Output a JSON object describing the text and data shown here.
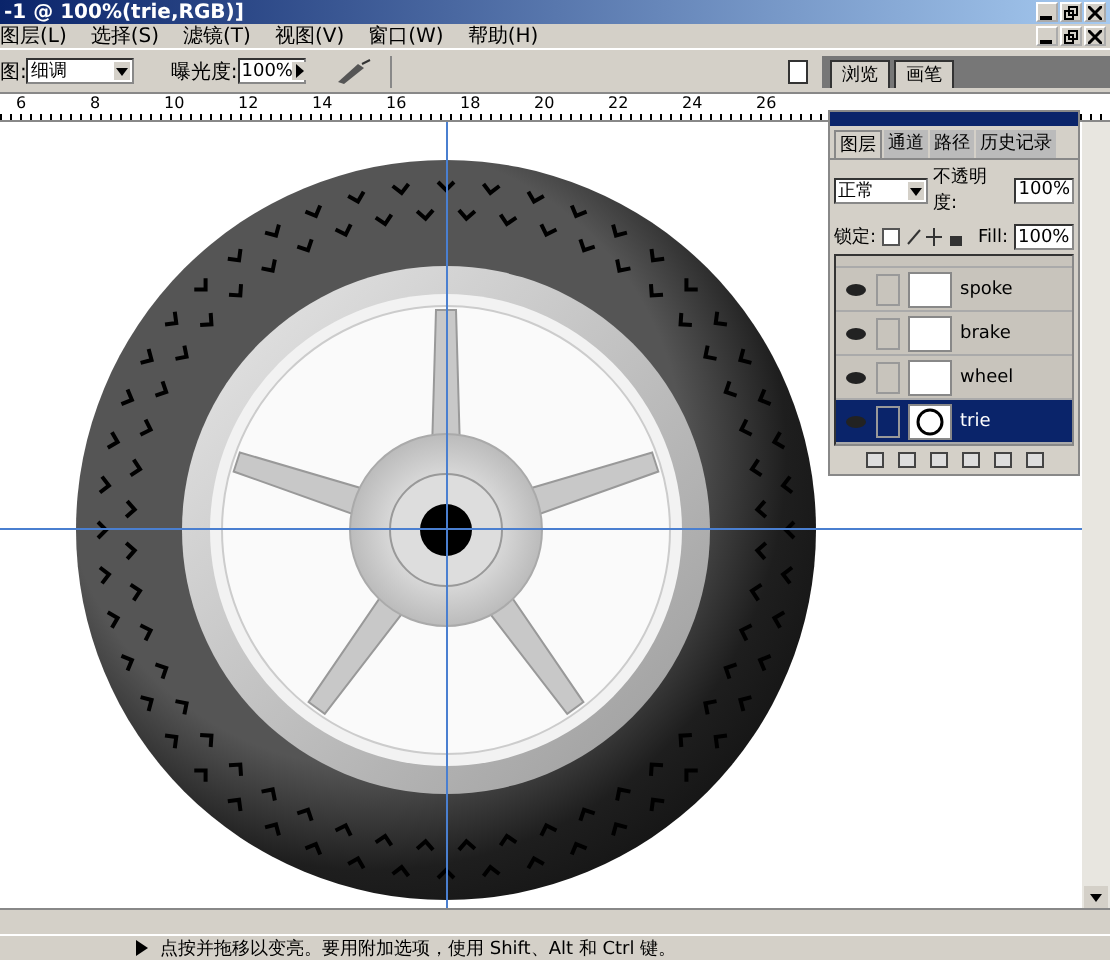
{
  "window": {
    "title": "-1 @ 100%(trie,RGB)]"
  },
  "menu": [
    "图层(L)",
    "选择(S)",
    "滤镜(T)",
    "视图(V)",
    "窗口(W)",
    "帮助(H)"
  ],
  "options": {
    "range_label": "图:",
    "range_value": "细调",
    "exposure_label": "曝光度:",
    "exposure_value": "100%"
  },
  "palette_well": {
    "tabs": [
      "浏览",
      "画笔"
    ]
  },
  "ruler": [
    "6",
    "8",
    "10",
    "12",
    "14",
    "16",
    "18",
    "20",
    "22",
    "24",
    "26"
  ],
  "layers_panel": {
    "tabs": [
      {
        "label": "图层",
        "selected": true
      },
      {
        "label": "通道",
        "selected": false
      },
      {
        "label": "路径",
        "selected": false
      },
      {
        "label": "历史记录",
        "selected": false
      }
    ],
    "blend_mode": "正常",
    "opacity_label": "不透明度:",
    "opacity": "100%",
    "lock_label": "锁定:",
    "fill_label": "Fill:",
    "fill": "100%",
    "layers": [
      {
        "name": "spoke",
        "visible": true,
        "selected": false
      },
      {
        "name": "brake",
        "visible": true,
        "selected": false
      },
      {
        "name": "wheel",
        "visible": true,
        "selected": false
      },
      {
        "name": "trie",
        "visible": true,
        "selected": true
      }
    ]
  },
  "status_bar": "点按并拖移以变亮。要用附加选项，使用 Shift、Alt 和 Ctrl 键。"
}
